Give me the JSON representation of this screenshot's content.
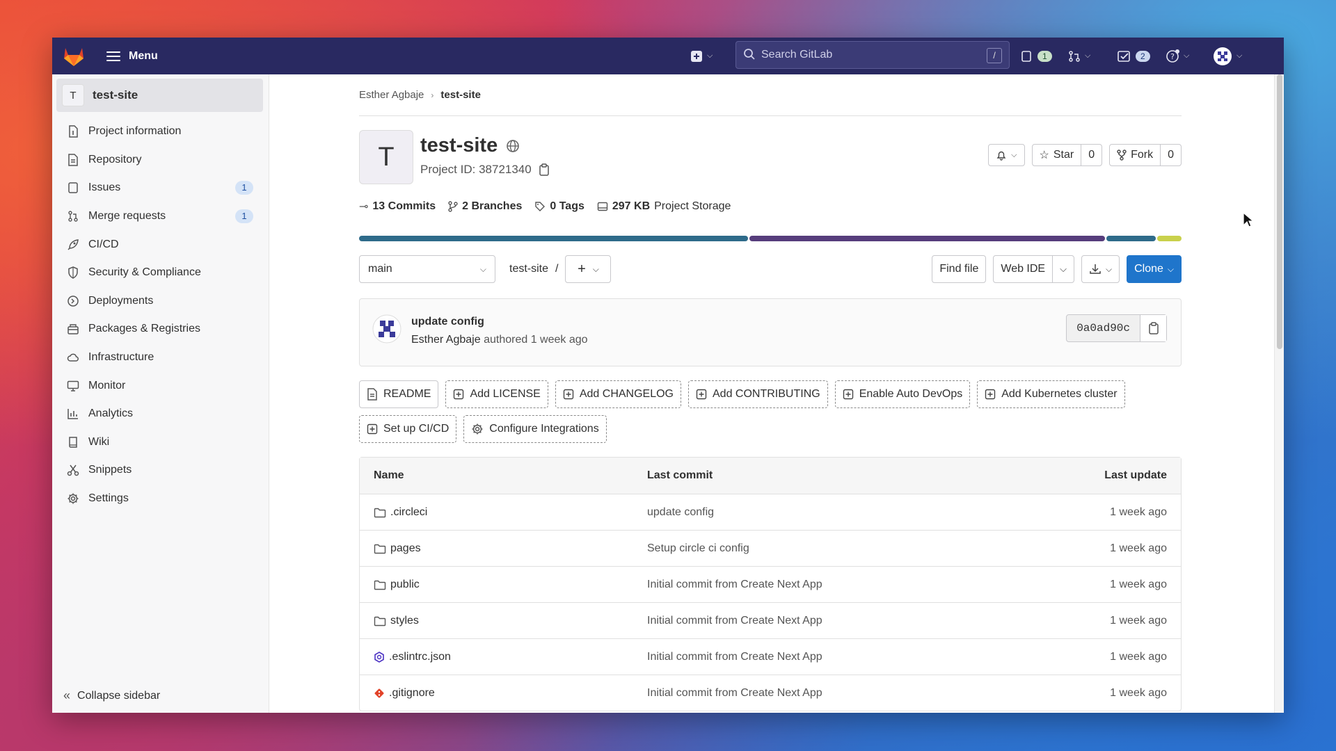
{
  "topbar": {
    "menu_label": "Menu",
    "search_placeholder": "Search GitLab",
    "search_shortcut": "/",
    "issues_count": "1",
    "todos_count": "2"
  },
  "sidebar": {
    "project_initial": "T",
    "project_name": "test-site",
    "items": [
      {
        "label": "Project information",
        "icon": "info-doc-icon"
      },
      {
        "label": "Repository",
        "icon": "doc-icon"
      },
      {
        "label": "Issues",
        "icon": "issues-icon",
        "badge": "1"
      },
      {
        "label": "Merge requests",
        "icon": "merge-request-icon",
        "badge": "1"
      },
      {
        "label": "CI/CD",
        "icon": "rocket-icon"
      },
      {
        "label": "Security & Compliance",
        "icon": "shield-icon"
      },
      {
        "label": "Deployments",
        "icon": "deployments-icon"
      },
      {
        "label": "Packages & Registries",
        "icon": "package-icon"
      },
      {
        "label": "Infrastructure",
        "icon": "cloud-icon"
      },
      {
        "label": "Monitor",
        "icon": "monitor-icon"
      },
      {
        "label": "Analytics",
        "icon": "chart-icon"
      },
      {
        "label": "Wiki",
        "icon": "book-icon"
      },
      {
        "label": "Snippets",
        "icon": "scissors-icon"
      },
      {
        "label": "Settings",
        "icon": "gear-icon"
      }
    ],
    "collapse_label": "Collapse sidebar"
  },
  "breadcrumb": {
    "owner": "Esther Agbaje",
    "project": "test-site"
  },
  "project": {
    "initial": "T",
    "title": "test-site",
    "id_label": "Project ID: 38721340",
    "star_label": "Star",
    "star_count": "0",
    "fork_label": "Fork",
    "fork_count": "0"
  },
  "stats": {
    "commits": "13 Commits",
    "branches": "2 Branches",
    "tags": "0 Tags",
    "storage_value": "297 KB",
    "storage_label": "Project Storage"
  },
  "languages": {
    "colors": [
      "#2e6b8a",
      "#563d7c",
      "#2e6b8a",
      "#c9d14c"
    ],
    "shares": [
      0.475,
      0.435,
      0.06,
      0.03
    ]
  },
  "branchbar": {
    "branch": "main",
    "path": "test-site",
    "separator": "/",
    "find_file": "Find file",
    "web_ide": "Web IDE",
    "clone": "Clone"
  },
  "commit": {
    "title": "update config",
    "author": "Esther Agbaje",
    "meta": "authored 1 week ago",
    "sha": "0a0ad90c"
  },
  "quick_actions": [
    {
      "label": "README",
      "icon": "doc-icon",
      "style": "solid"
    },
    {
      "label": "Add LICENSE",
      "icon": "plus-square-icon",
      "style": "dashed"
    },
    {
      "label": "Add CHANGELOG",
      "icon": "plus-square-icon",
      "style": "dashed"
    },
    {
      "label": "Add CONTRIBUTING",
      "icon": "plus-square-icon",
      "style": "dashed"
    },
    {
      "label": "Enable Auto DevOps",
      "icon": "plus-square-icon",
      "style": "dashed"
    },
    {
      "label": "Add Kubernetes cluster",
      "icon": "plus-square-icon",
      "style": "dashed"
    },
    {
      "label": "Set up CI/CD",
      "icon": "plus-square-icon",
      "style": "dashed"
    },
    {
      "label": "Configure Integrations",
      "icon": "gear-icon",
      "style": "dashed"
    }
  ],
  "files": {
    "headers": {
      "name": "Name",
      "last_commit": "Last commit",
      "last_update": "Last update"
    },
    "rows": [
      {
        "name": ".circleci",
        "type": "folder",
        "commit": "update config",
        "updated": "1 week ago"
      },
      {
        "name": "pages",
        "type": "folder",
        "commit": "Setup circle ci config",
        "updated": "1 week ago"
      },
      {
        "name": "public",
        "type": "folder",
        "commit": "Initial commit from Create Next App",
        "updated": "1 week ago"
      },
      {
        "name": "styles",
        "type": "folder",
        "commit": "Initial commit from Create Next App",
        "updated": "1 week ago"
      },
      {
        "name": ".eslintrc.json",
        "type": "eslint",
        "commit": "Initial commit from Create Next App",
        "updated": "1 week ago"
      },
      {
        "name": ".gitignore",
        "type": "git",
        "commit": "Initial commit from Create Next App",
        "updated": "1 week ago"
      }
    ]
  }
}
